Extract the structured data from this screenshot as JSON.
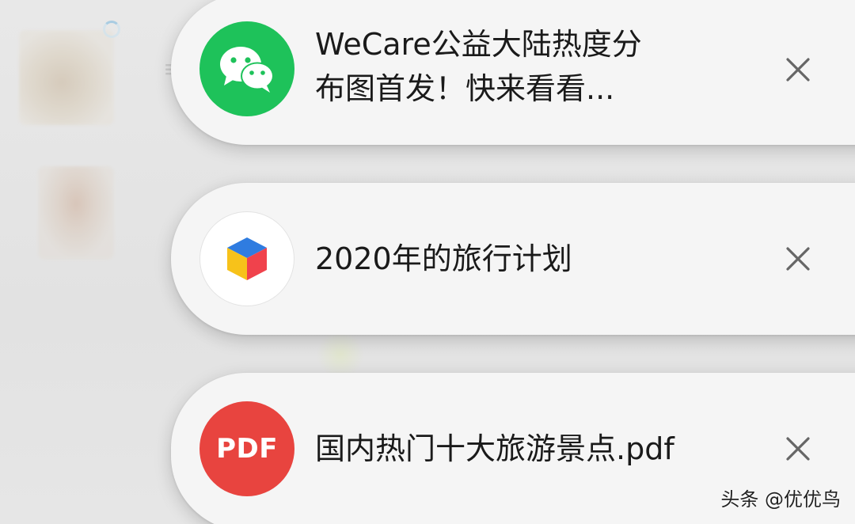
{
  "notifications": [
    {
      "app_icon": "wechat-icon",
      "icon_color": "#1ec25a",
      "title_lines": [
        "WeCare公益大陆热度分",
        "布图首发！快来看看..."
      ],
      "close_icon": "close-icon"
    },
    {
      "app_icon": "cube-app-icon",
      "icon_color": "#ffffff",
      "title_lines": [
        "2020年的旅行计划"
      ],
      "close_icon": "close-icon"
    },
    {
      "app_icon": "pdf-icon",
      "icon_color": "#e8443f",
      "icon_label": "PDF",
      "title_lines": [
        "国内热门十大旅游景点.pdf"
      ],
      "close_icon": "close-icon"
    }
  ],
  "watermark": {
    "text": "头条 @优优鸟"
  },
  "colors": {
    "card_background": "#f5f5f5",
    "page_background": "#e4e4e4",
    "text": "#1a1a1a",
    "close_icon": "#666666"
  }
}
